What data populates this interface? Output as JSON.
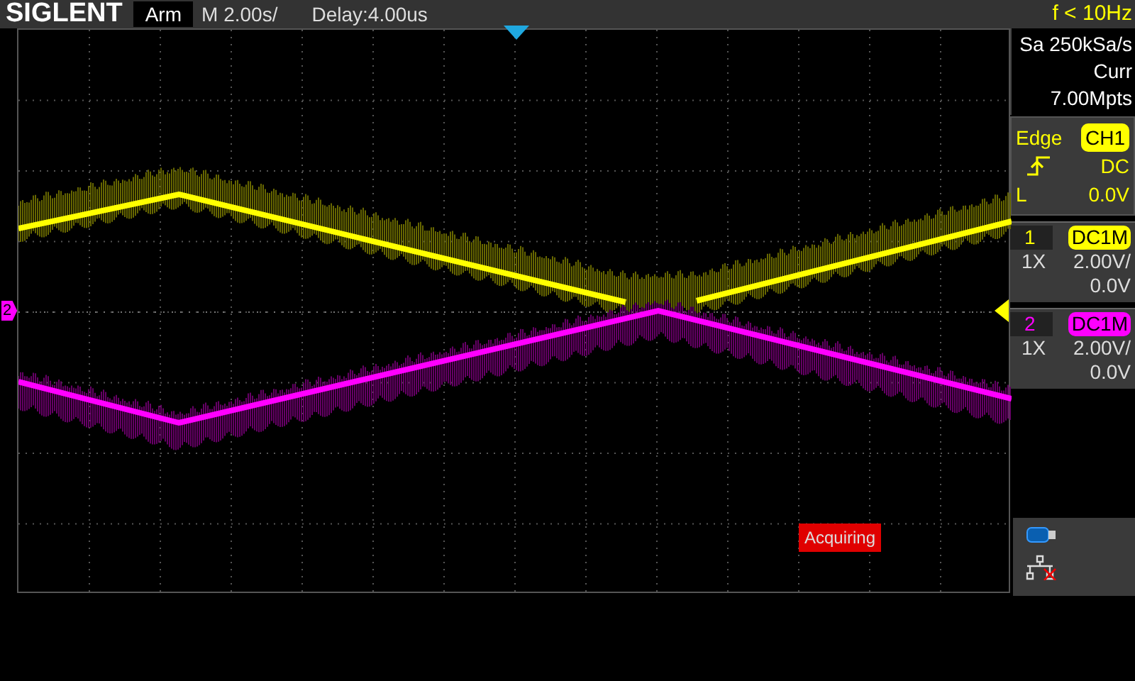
{
  "header": {
    "brand": "SIGLENT",
    "run_state": "Arm",
    "timebase": "M 2.00s/",
    "delay": "Delay:4.00us",
    "frequency": "f < 10Hz"
  },
  "acquisition": {
    "sample_rate": "Sa 250kSa/s",
    "memory_depth": "Curr 7.00Mpts"
  },
  "trigger": {
    "type": "Edge",
    "source": "CH1",
    "coupling": "DC",
    "mode": "L",
    "level": "0.0V"
  },
  "channels": [
    {
      "number": "1",
      "coupling": "DC1M",
      "probe": "1X",
      "scale": "2.00V/",
      "offset": "0.0V",
      "color": "#ffff00"
    },
    {
      "number": "2",
      "coupling": "DC1M",
      "probe": "1X",
      "scale": "2.00V/",
      "offset": "0.0V",
      "color": "#ff00ff",
      "ground_marker": "2"
    }
  ],
  "status": "Acquiring"
}
